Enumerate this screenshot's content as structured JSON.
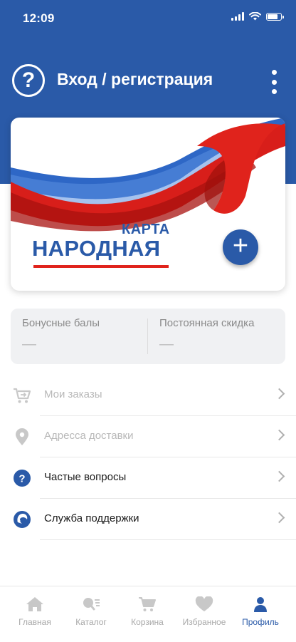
{
  "status_bar": {
    "time": "12:09"
  },
  "header": {
    "title": "Вход / регистрация",
    "help_icon": "question-circle-icon",
    "menu_icon": "more-vertical-icon"
  },
  "card": {
    "line1": "КАРТА",
    "line2": "НАРОДНАЯ",
    "add_icon": "plus-icon"
  },
  "bonus": {
    "points_label": "Бонусные балы",
    "points_value": "—",
    "discount_label": "Постоянная скидка",
    "discount_value": "—"
  },
  "menu": {
    "items": [
      {
        "label": "Мои заказы",
        "icon": "cart-arrow-icon"
      },
      {
        "label": "Адресса доставки",
        "icon": "location-pin-icon"
      },
      {
        "label": "Частые вопросы",
        "icon": "question-icon"
      },
      {
        "label": "Служба поддержки",
        "icon": "support-headset-icon"
      }
    ]
  },
  "tabbar": {
    "tabs": [
      {
        "label": "Главная",
        "icon": "home-icon"
      },
      {
        "label": "Каталог",
        "icon": "catalog-search-icon"
      },
      {
        "label": "Корзина",
        "icon": "cart-icon"
      },
      {
        "label": "Избранное",
        "icon": "heart-icon"
      },
      {
        "label": "Профиль",
        "icon": "user-icon"
      }
    ],
    "active": "Профиль"
  },
  "colors": {
    "brand": "#2a5aa8",
    "accent_red": "#e0231c",
    "muted": "#b8b8b8"
  }
}
